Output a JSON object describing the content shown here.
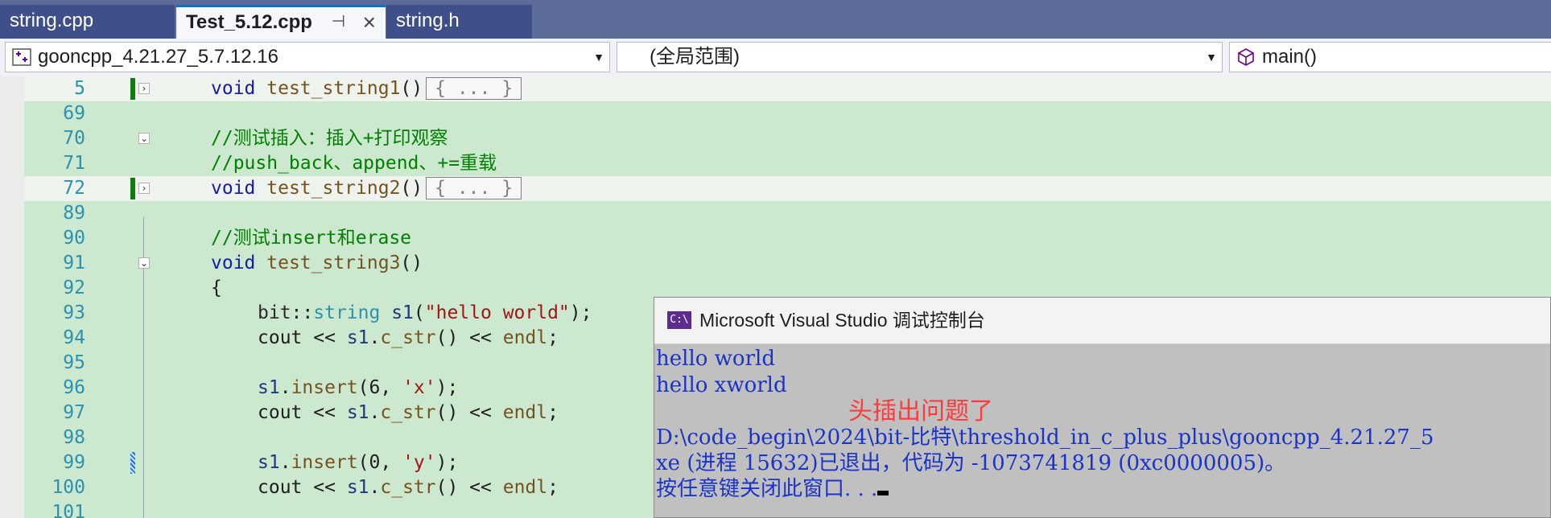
{
  "tabs": [
    {
      "label": "string.cpp",
      "active": false
    },
    {
      "label": "Test_5.12.cpp",
      "active": true
    },
    {
      "label": "string.h",
      "active": false
    }
  ],
  "nav": {
    "project": "gooncpp_4.21.27_5.7.12.16",
    "scope": "(全局范围)",
    "member": "main()"
  },
  "editor": {
    "lines": [
      {
        "num": "5"
      },
      {
        "num": "69"
      },
      {
        "num": "70"
      },
      {
        "num": "71"
      },
      {
        "num": "72"
      },
      {
        "num": "89"
      },
      {
        "num": "90"
      },
      {
        "num": "91"
      },
      {
        "num": "92"
      },
      {
        "num": "93"
      },
      {
        "num": "94"
      },
      {
        "num": "95"
      },
      {
        "num": "96"
      },
      {
        "num": "97"
      },
      {
        "num": "98"
      },
      {
        "num": "99"
      },
      {
        "num": "100"
      },
      {
        "num": "101"
      }
    ],
    "tokens": {
      "void": "void",
      "fn1": "test_string1",
      "fn2": "test_string2",
      "fn3": "test_string3",
      "parens": "()",
      "collapsed": "{ ... }",
      "comment70": "//测试插入：插入+打印观察",
      "comment71": "//push_back、append、+=重载",
      "comment90": "//测试insert和erase",
      "brace_open": "{",
      "bit": "bit",
      "scope_op": "::",
      "string_type": "string",
      "s1": "s1",
      "hello_world_lit": "\"hello world\"",
      "cout": "cout",
      "shift": "<<",
      "c_str": "c_str",
      "endl": "endl",
      "insert": "insert",
      "six": "6",
      "zero": "0",
      "x_lit": "'x'",
      "y_lit": "'y'"
    }
  },
  "console": {
    "icon_text": "C:\\",
    "title": "Microsoft Visual Studio 调试控制台",
    "lines": [
      "hello world",
      "hello xworld",
      "",
      "D:\\code_begin\\2024\\bit-比特\\threshold_in_c_plus_plus\\gooncpp_4.21.27_5",
      "xe (进程 15632)已退出，代码为 -1073741819 (0xc0000005)。",
      "按任意键关闭此窗口. . ."
    ]
  },
  "annotation": "头插出问题了",
  "colors": {
    "tab_bar": "#5d6b99",
    "editor_bg": "#cce8cf",
    "console_bg": "#c0c0c0",
    "console_text": "#1a33c8",
    "annotation": "#ff3a3a",
    "change_marker": "#107c10"
  }
}
